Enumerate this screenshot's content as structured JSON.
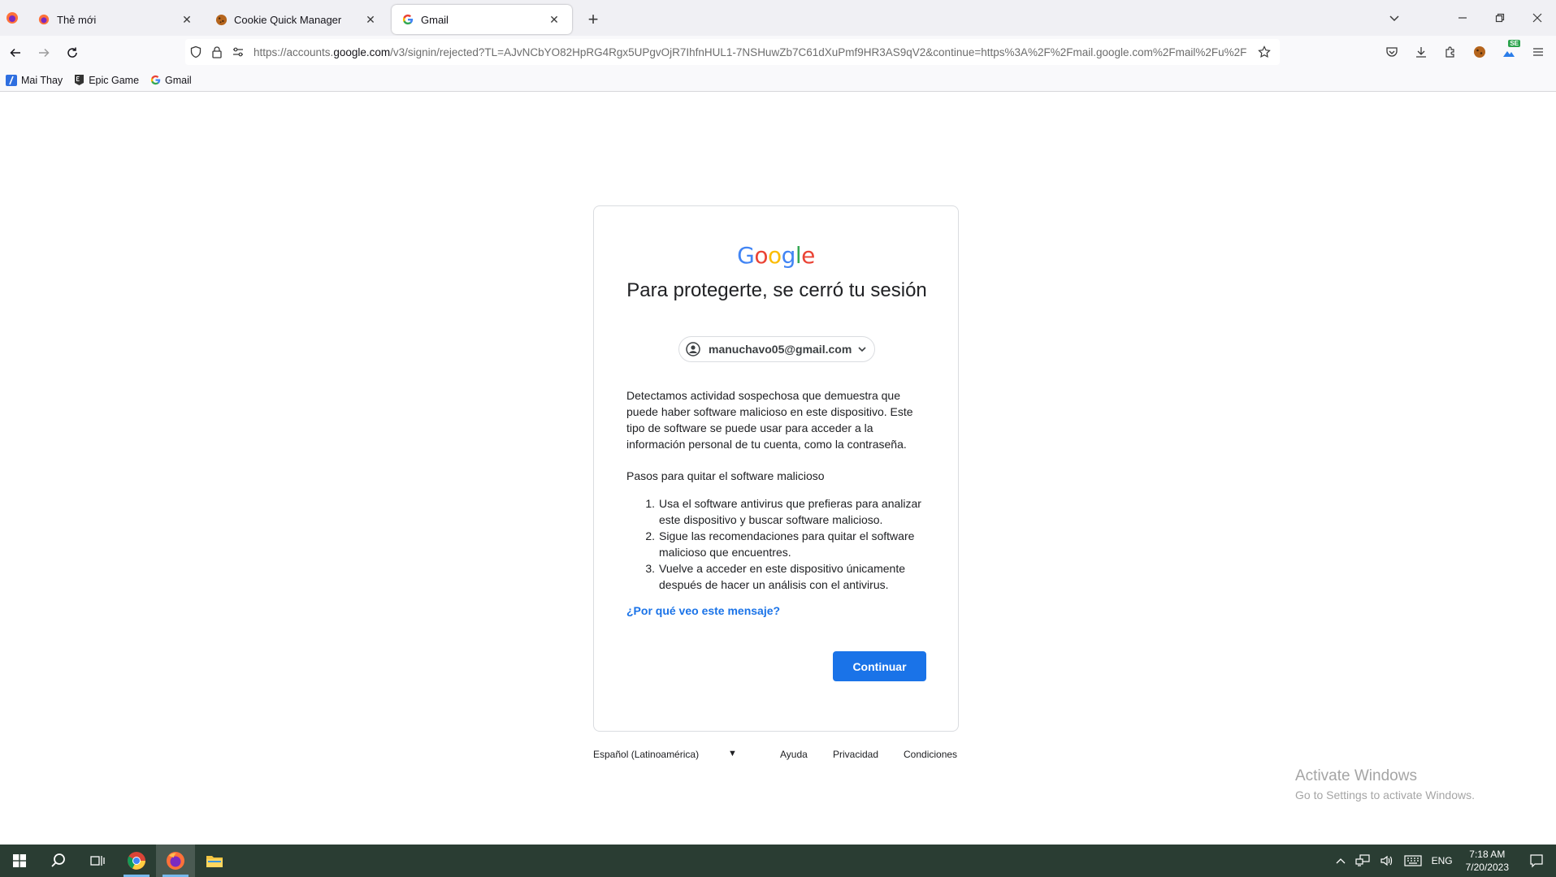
{
  "browser": {
    "tabs": [
      {
        "title": "Thẻ mới",
        "active": false
      },
      {
        "title": "Cookie Quick Manager",
        "active": false
      },
      {
        "title": "Gmail",
        "active": true
      }
    ],
    "url": {
      "prefix": "https://accounts.",
      "host": "google.com",
      "rest": "/v3/signin/rejected?TL=AJvNCbYO82HpRG4Rgx5UPgvOjR7IhfnHUL1-7NSHuwZb7C61dXuPmf9HR3AS9qV2&continue=https%3A%2F%2Fmail.google.com%2Fmail%2Fu%2F"
    },
    "extension_badge": "SE",
    "bookmarks": [
      {
        "label": "Mai Thay"
      },
      {
        "label": "Epic Game"
      },
      {
        "label": "Gmail"
      }
    ]
  },
  "page": {
    "logo_letters": [
      "G",
      "o",
      "o",
      "g",
      "l",
      "e"
    ],
    "logo_colors": [
      "#4285F4",
      "#EA4335",
      "#FBBC05",
      "#4285F4",
      "#34A853",
      "#EA4335"
    ],
    "headline": "Para protegerte, se cerró tu sesión",
    "account_email": "manuchavo05@gmail.com",
    "body": "Detectamos actividad sospechosa que demuestra que puede haber software malicioso en este dispositivo. Este tipo de software se puede usar para acceder a la información personal de tu cuenta, como la contraseña.",
    "steps_title": "Pasos para quitar el software malicioso",
    "steps": [
      {
        "num": "1.",
        "text": "Usa el software antivirus que prefieras para analizar este dispositivo y buscar software malicioso."
      },
      {
        "num": "2.",
        "text": "Sigue las recomendaciones para quitar el software malicioso que encuentres."
      },
      {
        "num": "3.",
        "text": "Vuelve a acceder en este dispositivo únicamente después de hacer un análisis con el antivirus."
      }
    ],
    "why_link": "¿Por qué veo este mensaje?",
    "continue_button": "Continuar",
    "accent_color": "#1a73e8"
  },
  "footer": {
    "language": "Español (Latinoamérica)",
    "links": [
      "Ayuda",
      "Privacidad",
      "Condiciones"
    ]
  },
  "watermark": {
    "line1": "Activate Windows",
    "line2": "Go to Settings to activate Windows."
  },
  "taskbar": {
    "language": "ENG",
    "time": "7:18 AM",
    "date": "7/20/2023"
  }
}
